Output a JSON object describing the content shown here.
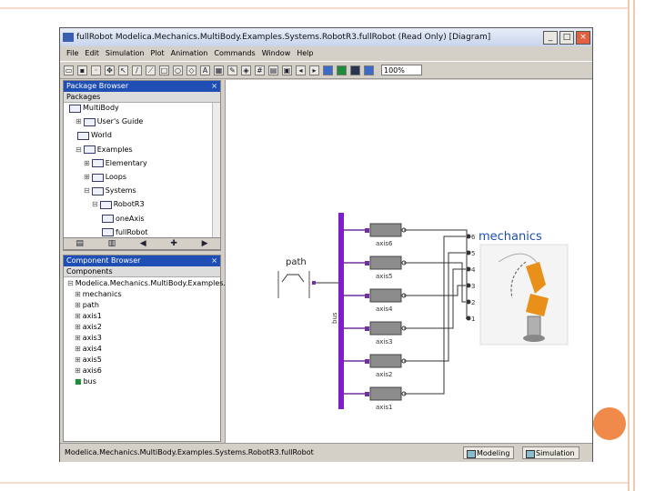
{
  "window": {
    "title": "fullRobot   Modelica.Mechanics.MultiBody.Examples.Systems.RobotR3.fullRobot   (Read Only)   [Diagram]",
    "min_label": "_",
    "max_label": "□",
    "close_label": "×"
  },
  "menu": [
    "File",
    "Edit",
    "Simulation",
    "Plot",
    "Animation",
    "Commands",
    "Window",
    "Help"
  ],
  "toolbar": {
    "zoom": "100%"
  },
  "package_browser": {
    "title": "Package Browser",
    "header": "Packages",
    "items": [
      {
        "label": "MultiBody",
        "indent": 0,
        "toggle": ""
      },
      {
        "label": "User's Guide",
        "indent": 1,
        "toggle": "⊞"
      },
      {
        "label": "World",
        "indent": 1,
        "toggle": ""
      },
      {
        "label": "Examples",
        "indent": 1,
        "toggle": "⊟"
      },
      {
        "label": "Elementary",
        "indent": 2,
        "toggle": "⊞"
      },
      {
        "label": "Loops",
        "indent": 2,
        "toggle": "⊞"
      },
      {
        "label": "Systems",
        "indent": 2,
        "toggle": "⊟"
      },
      {
        "label": "RobotR3",
        "indent": 3,
        "toggle": "⊟"
      },
      {
        "label": "oneAxis",
        "indent": 4,
        "toggle": ""
      },
      {
        "label": "fullRobot",
        "indent": 4,
        "toggle": ""
      }
    ],
    "close_label": "×"
  },
  "component_browser": {
    "title": "Component Browser",
    "header": "Components",
    "root": "Modelica.Mechanics.MultiBody.Examples.Sy",
    "items": [
      "mechanics",
      "path",
      "axis1",
      "axis2",
      "axis3",
      "axis4",
      "axis5",
      "axis6",
      "bus"
    ],
    "close_label": "×"
  },
  "diagram": {
    "path_label": "path",
    "bus_label": "bus",
    "mechanics_label": "mechanics",
    "axes": [
      "axis6",
      "axis5",
      "axis4",
      "axis3",
      "axis2",
      "axis1"
    ],
    "ports": [
      "6",
      "5",
      "4",
      "3",
      "2",
      "1"
    ]
  },
  "status": {
    "text": "Modelica.Mechanics.MultiBody.Examples.Systems.RobotR3.fullRobot",
    "modeling": "Modeling",
    "simulation": "Simulation"
  },
  "colors": {
    "bus": "#7b1fc8",
    "axis_fill": "#8c8c8c",
    "port": "#7030a0",
    "mechanics_title": "#1f4fb4",
    "robot": "#e8901a"
  }
}
